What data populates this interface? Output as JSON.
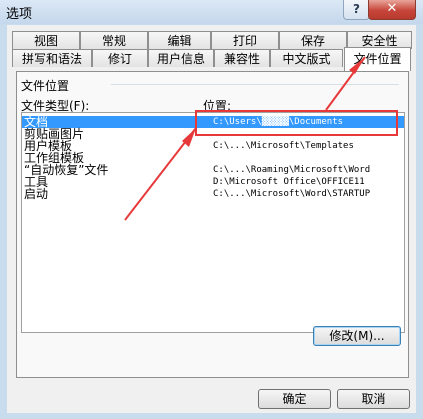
{
  "window": {
    "title": "选项",
    "help": "?",
    "close": "✕"
  },
  "tabs_row1": [
    "视图",
    "常规",
    "编辑",
    "打印",
    "保存",
    "安全性"
  ],
  "tabs_row2": [
    "拼写和语法",
    "修订",
    "用户信息",
    "兼容性",
    "中文版式",
    "文件位置"
  ],
  "active_tab": "文件位置",
  "panel": {
    "group_title": "文件位置",
    "type_header": "文件类型(F):",
    "location_header": "位置:",
    "rows": [
      {
        "type": "文档",
        "path": "C:\\Users\\▓▓▓▓▓\\Documents",
        "selected": true
      },
      {
        "type": "剪贴画图片",
        "path": ""
      },
      {
        "type": "用户模板",
        "path": "C:\\...\\Microsoft\\Templates"
      },
      {
        "type": "工作组模板",
        "path": ""
      },
      {
        "type": "“自动恢复”文件",
        "path": "C:\\...\\Roaming\\Microsoft\\Word"
      },
      {
        "type": "工具",
        "path": "D:\\Microsoft Office\\OFFICE11"
      },
      {
        "type": "启动",
        "path": "C:\\...\\Microsoft\\Word\\STARTUP"
      }
    ],
    "modify_button": "修改(M)..."
  },
  "footer": {
    "ok": "确定",
    "cancel": "取消"
  },
  "colors": {
    "selection": "#3399ff",
    "annotation": "#e8393a"
  }
}
